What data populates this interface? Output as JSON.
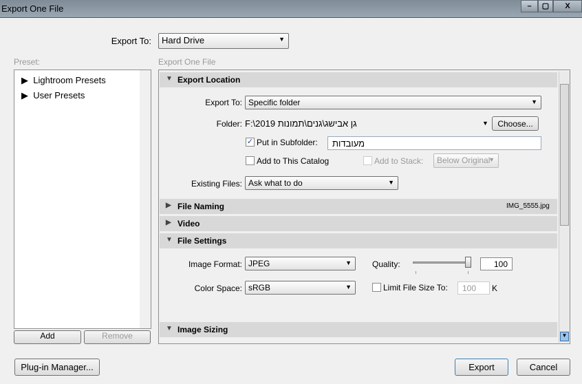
{
  "window": {
    "title": "Export One File",
    "min": "–",
    "max": "▢",
    "close": "X"
  },
  "export_to": {
    "label": "Export To:",
    "value": "Hard Drive"
  },
  "preset": {
    "header": "Preset:",
    "items": [
      "Lightroom Presets",
      "User Presets"
    ],
    "add": "Add",
    "remove": "Remove"
  },
  "main_header": "Export One File",
  "sections": {
    "export_location": {
      "title": "Export Location",
      "export_to_label": "Export To:",
      "export_to_value": "Specific folder",
      "folder_label": "Folder:",
      "folder_value": "F:\\2019 גן אבישג\\גנים\\תמונות",
      "choose": "Choose...",
      "put_in_subfolder": "Put in Subfolder:",
      "put_in_subfolder_checked": true,
      "subfolder_value": "מעובדות",
      "add_to_catalog": "Add to This Catalog",
      "add_to_stack": "Add to Stack:",
      "stack_value": "Below Original",
      "existing_files_label": "Existing Files:",
      "existing_files_value": "Ask what to do"
    },
    "file_naming": {
      "title": "File Naming",
      "filename": "IMG_5555.jpg"
    },
    "video": {
      "title": "Video"
    },
    "file_settings": {
      "title": "File Settings",
      "image_format_label": "Image Format:",
      "image_format_value": "JPEG",
      "quality_label": "Quality:",
      "quality_value": "100",
      "quality_fraction": 1.0,
      "color_space_label": "Color Space:",
      "color_space_value": "sRGB",
      "limit_label": "Limit File Size To:",
      "limit_value": "100",
      "limit_unit": "K"
    },
    "image_sizing": {
      "title": "Image Sizing"
    }
  },
  "footer": {
    "plugin_manager": "Plug-in Manager...",
    "export": "Export",
    "cancel": "Cancel"
  }
}
